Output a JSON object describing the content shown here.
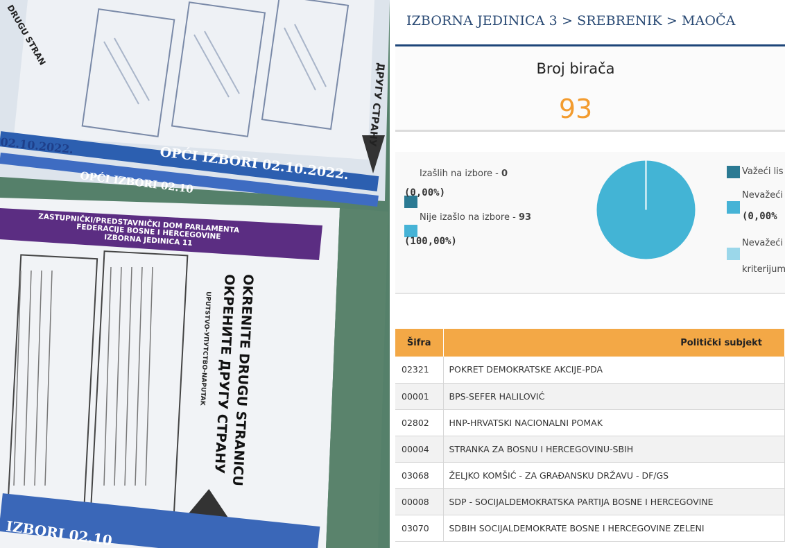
{
  "photo": {
    "ballot_top_footer": "OPĆI IZBORI 02.10.2022.",
    "ballot_top_left_date": "02.10.2022.",
    "ballot_mid_footer": "OPĆI IZBORI 02.10",
    "ballot_header_line1": "ZASTUPNIČKI/PREDSTAVNIČKI DOM PARLAMENTA",
    "ballot_header_line2": "FEDERACIJE BOSNE I HERCEGOVINE",
    "ballot_header_line3": "IZBORNA JEDINICA 11",
    "ballot_turn_latin": "OKRENITE DRUGU STRANICU",
    "ballot_turn_cyrillic": "ОКРЕНИТЕ ДРУГУ СТРАНУ",
    "ballot_instructions_title": "UPUTSTVO-УПУТСТВО-NAPUTAK",
    "ballot_top_turn_cyrillic": "ДРУГУ СТРАНУ",
    "ballot_bottom_footer": "IZBORI 02.10",
    "ballot_top_left_header": "DRUGU STRAN"
  },
  "panel": {
    "breadcrumb": "IZBORNA JEDINICA 3 > SREBRENIK > MAOČA",
    "voters_title": "Broj birača",
    "voters_count": "93",
    "stats": {
      "left": [
        {
          "label": "Izašlih na izbore - ",
          "value": "0",
          "pct": "(0,00%)",
          "color": "#2b7a93"
        },
        {
          "label": "Nije izašlo na izbore - ",
          "value": "93",
          "pct": "(100,00%)",
          "color": "#46b3d6"
        }
      ],
      "right": [
        {
          "label": "Važeći lis",
          "color": "#2b7a93"
        },
        {
          "label": "Nevažeći",
          "pct": "(0,00%",
          "color": "#46b3d6"
        },
        {
          "label": "Nevažeći",
          "label2": "kriterijum",
          "color": "#9bd7ea"
        }
      ]
    },
    "pie_fill": "#43b4d5",
    "table": {
      "headers": [
        "Šifra",
        "Politički subjekt"
      ],
      "rows": [
        {
          "code": "02321",
          "name": "POKRET DEMOKRATSKE AKCIJE-PDA"
        },
        {
          "code": "00001",
          "name": "BPS-SEFER HALILOVIĆ"
        },
        {
          "code": "02802",
          "name": "HNP-HRVATSKI NACIONALNI POMAK"
        },
        {
          "code": "00004",
          "name": "STRANKA ZA BOSNU I HERCEGOVINU-SBIH"
        },
        {
          "code": "03068",
          "name": "ŽELJKO KOMŠIĆ - ZA GRAĐANSKU DRŽAVU - DF/GS"
        },
        {
          "code": "00008",
          "name": "SDP - SOCIJALDEMOKRATSKA PARTIJA BOSNE I HERCEGOVINE"
        },
        {
          "code": "03070",
          "name": "SDBIH SOCIJALDEMOKRATE BOSNE I HERCEGOVINE ZELENI"
        }
      ]
    }
  }
}
